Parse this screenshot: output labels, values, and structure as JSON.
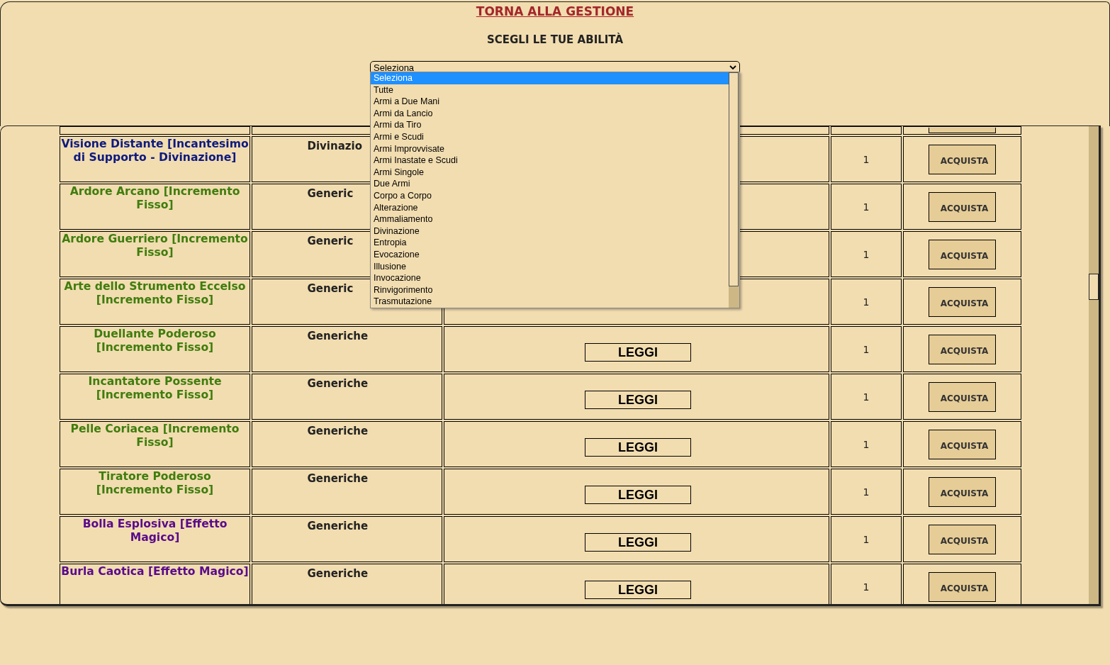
{
  "back_link": "TORNA ALLA GESTIONE",
  "heading": "SCEGLI LE TUE ABILITÀ",
  "filter_select": {
    "value": "Seleziona",
    "expanded": true,
    "options": [
      {
        "label": "Seleziona",
        "selected": true
      },
      {
        "label": "Tutte",
        "selected": false
      },
      {
        "label": "Armi a Due Mani",
        "selected": false
      },
      {
        "label": "Armi da Lancio",
        "selected": false
      },
      {
        "label": "Armi da Tiro",
        "selected": false
      },
      {
        "label": "Armi e Scudi",
        "selected": false
      },
      {
        "label": "Armi Improvvisate",
        "selected": false
      },
      {
        "label": "Armi Inastate e Scudi",
        "selected": false
      },
      {
        "label": "Armi Singole",
        "selected": false
      },
      {
        "label": "Due Armi",
        "selected": false
      },
      {
        "label": "Corpo a Corpo",
        "selected": false
      },
      {
        "label": "Alterazione",
        "selected": false
      },
      {
        "label": "Ammaliamento",
        "selected": false
      },
      {
        "label": "Divinazione",
        "selected": false
      },
      {
        "label": "Entropia",
        "selected": false
      },
      {
        "label": "Evocazione",
        "selected": false
      },
      {
        "label": "Illusione",
        "selected": false
      },
      {
        "label": "Invocazione",
        "selected": false
      },
      {
        "label": "Rinvigorimento",
        "selected": false
      },
      {
        "label": "Trasmutazione",
        "selected": false
      }
    ]
  },
  "table": {
    "rows": [
      {
        "name": "Visione Distante [Incantesimo di Supporto - Divinazione]",
        "color": "#0d1a80",
        "category": "Divinazio",
        "cost": "1",
        "buy_button": "ACQUISTA"
      },
      {
        "name": "Ardore Arcano [Incremento Fisso]",
        "color": "#3f7d0e",
        "category": "Generic",
        "cost": "1",
        "buy_button": "ACQUISTA"
      },
      {
        "name": "Ardore Guerriero [Incremento Fisso]",
        "color": "#3f7d0e",
        "category": "Generic",
        "cost": "1",
        "buy_button": "ACQUISTA"
      },
      {
        "name": "Arte dello Strumento Eccelso [Incremento Fisso]",
        "color": "#3f7d0e",
        "category": "Generic",
        "cost": "1",
        "buy_button": "ACQUISTA"
      },
      {
        "name": "Duellante Poderoso [Incremento Fisso]",
        "color": "#3f7d0e",
        "category": "Generiche",
        "read_button": "LEGGI",
        "cost": "1",
        "buy_button": "ACQUISTA"
      },
      {
        "name": "Incantatore Possente [Incremento Fisso]",
        "color": "#3f7d0e",
        "category": "Generiche",
        "read_button": "LEGGI",
        "cost": "1",
        "buy_button": "ACQUISTA"
      },
      {
        "name": "Pelle Coriacea [Incremento Fisso]",
        "color": "#3f7d0e",
        "category": "Generiche",
        "read_button": "LEGGI",
        "cost": "1",
        "buy_button": "ACQUISTA"
      },
      {
        "name": "Tiratore Poderoso [Incremento Fisso]",
        "color": "#3f7d0e",
        "category": "Generiche",
        "read_button": "LEGGI",
        "cost": "1",
        "buy_button": "ACQUISTA"
      },
      {
        "name": "Bolla Esplosiva [Effetto Magico]",
        "color": "#5a0a8c",
        "category": "Generiche",
        "read_button": "LEGGI",
        "cost": "1",
        "buy_button": "ACQUISTA"
      },
      {
        "name": "Burla Caotica [Effetto Magico]",
        "color": "#5a0a8c",
        "category": "Generiche",
        "read_button": "LEGGI",
        "cost": "1",
        "buy_button": "ACQUISTA"
      }
    ]
  }
}
